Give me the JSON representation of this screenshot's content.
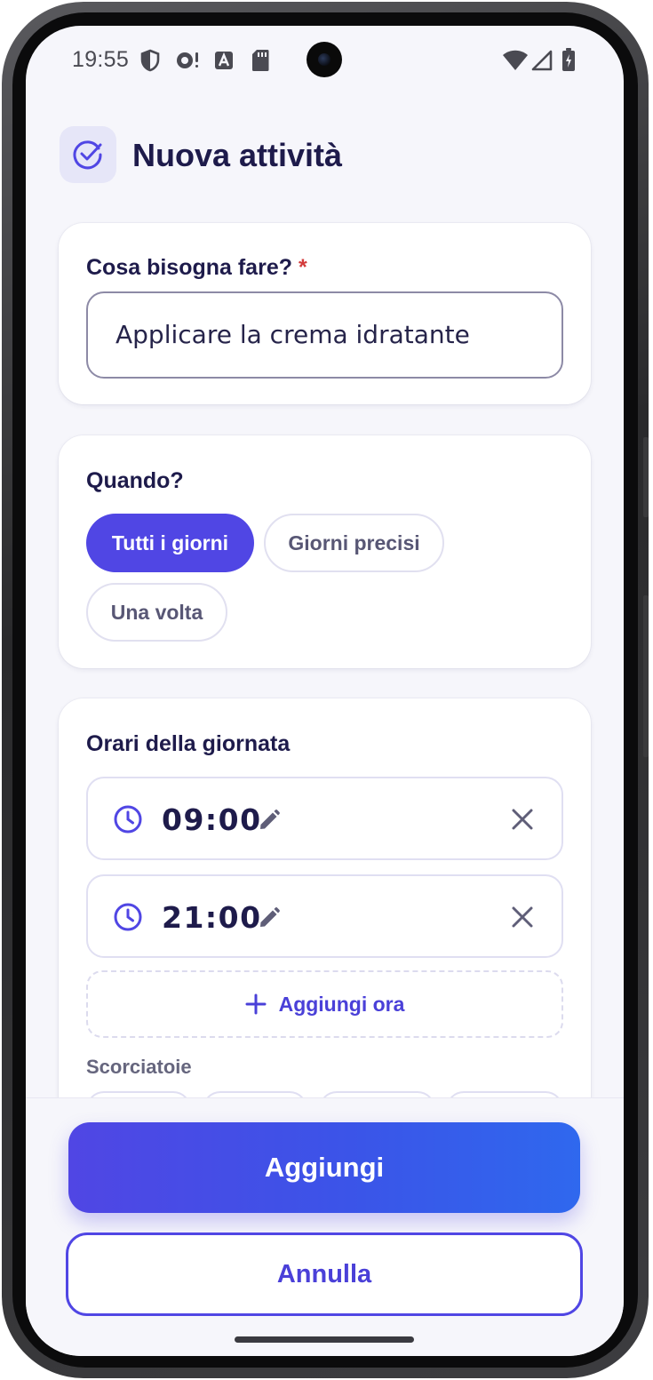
{
  "status_bar": {
    "time": "19:55",
    "left_icons": [
      "shield-icon",
      "cloud-sync-alert-icon",
      "font-a-icon",
      "sd-card-icon"
    ],
    "right_icons": [
      "wifi-icon",
      "cellular-signal-icon",
      "battery-charging-icon"
    ]
  },
  "header": {
    "title": "Nuova attività",
    "icon": "check-circle-icon"
  },
  "task": {
    "label": "Cosa bisogna fare?",
    "required_marker": "*",
    "value": "Applicare la crema idratante"
  },
  "when": {
    "label": "Quando?",
    "options": [
      "Tutti i giorni",
      "Giorni precisi",
      "Una volta"
    ],
    "selected": "Tutti i giorni"
  },
  "times": {
    "label": "Orari della giornata",
    "entries": [
      {
        "time": "09:00"
      },
      {
        "time": "21:00"
      }
    ],
    "add_label": "Aggiungi ora",
    "shortcuts_label": "Scorciatoie"
  },
  "actions": {
    "primary": "Aggiungi",
    "secondary": "Annulla"
  },
  "colors": {
    "accent": "#5046e4",
    "title": "#1e1b4b",
    "required": "#d33b3b",
    "background": "#f6f6fb"
  }
}
